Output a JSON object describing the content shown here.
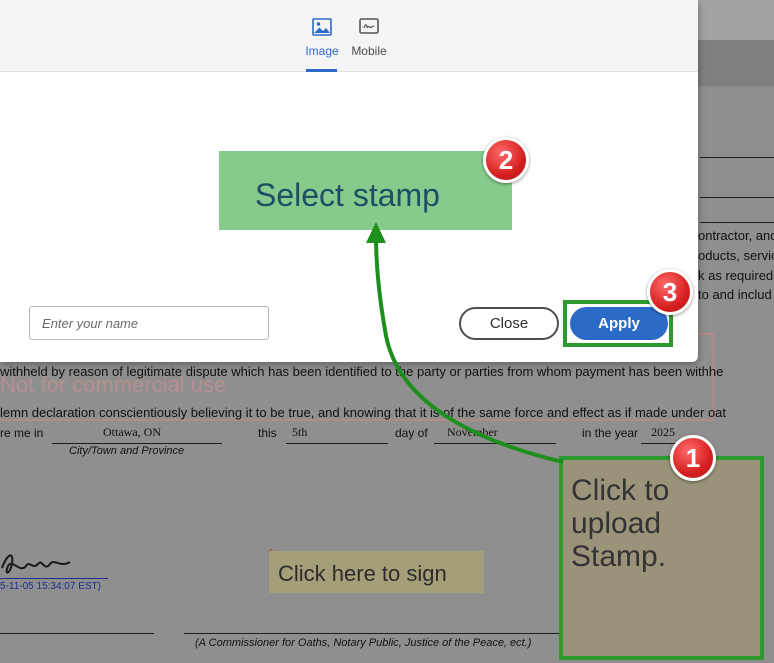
{
  "modal": {
    "tabs": [
      {
        "label": "Image",
        "icon": "image-icon",
        "active": true
      },
      {
        "label": "Mobile",
        "icon": "signature-icon",
        "active": false
      }
    ],
    "name_placeholder": "Enter your name",
    "close_label": "Close",
    "apply_label": "Apply"
  },
  "document": {
    "right_frags": [
      "ontractor, and",
      "oducts, servic",
      "k as required",
      "to and includ"
    ],
    "watermark": "Not for commercial use",
    "line1": "withheld by reason of legitimate dispute which has been identified to the party or parties from whom payment has been withhe",
    "line2": "lemn declaration conscientiously believing it to be true, and knowing that it is of the same force and effect as if made under oat",
    "declared": {
      "prefix": "re me in",
      "city": "Ottawa, ON",
      "this": "this",
      "day": "5th",
      "day_of": "day of",
      "month": "November",
      "in_year": "in the year",
      "year": "2025"
    },
    "city_caption": "City/Town and Province",
    "signature_date": "5-11-05 15:34:07 EST)",
    "sign_here": "Click here to sign",
    "commissioner_caption": "(A Commissioner for Oaths, Notary Public, Justice of the Peace, ect.)"
  },
  "tutorial": {
    "select_stamp": "Select stamp",
    "upload_text": "Click to upload Stamp.",
    "badges": [
      "1",
      "2",
      "3"
    ]
  },
  "colors": {
    "accent": "#2c69c9",
    "highlight_green": "#2c9a2c",
    "badge_red": "#d51f1f"
  }
}
